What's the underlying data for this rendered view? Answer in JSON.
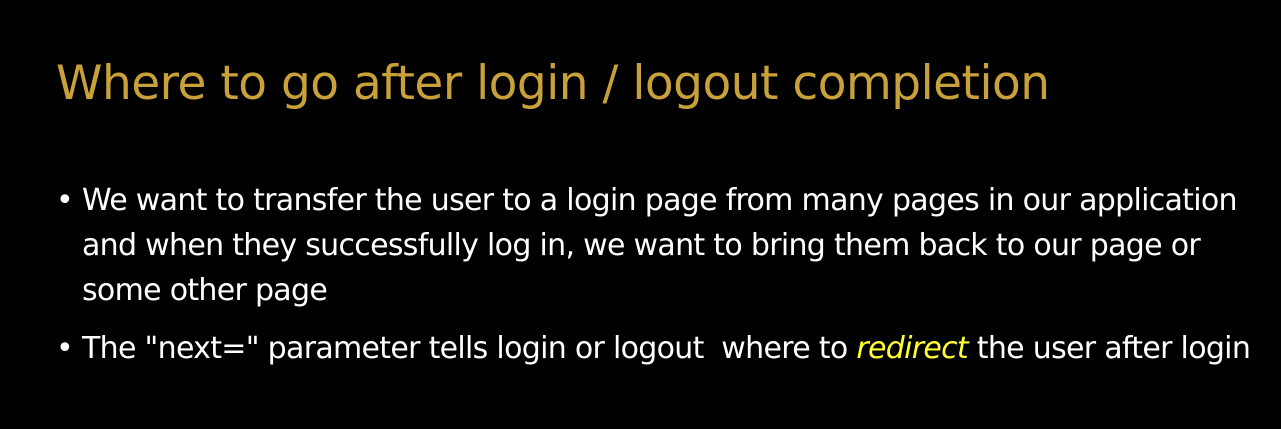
{
  "slide": {
    "title": "Where to go after login / logout completion",
    "bullet_symbol": "•",
    "bullets": [
      {
        "text": "We want to transfer the user to a login page from many pages in our application and when they successfully log in, we want to bring them back to our page or some other page"
      },
      {
        "before": "The \"next=\" parameter tells login or logout  where to ",
        "emphasis": "redirect",
        "after": " the user after login"
      }
    ]
  },
  "colors": {
    "background": "#000000",
    "title": "#c9a13a",
    "body_text": "#ffffff",
    "emphasis": "#ffff33"
  }
}
